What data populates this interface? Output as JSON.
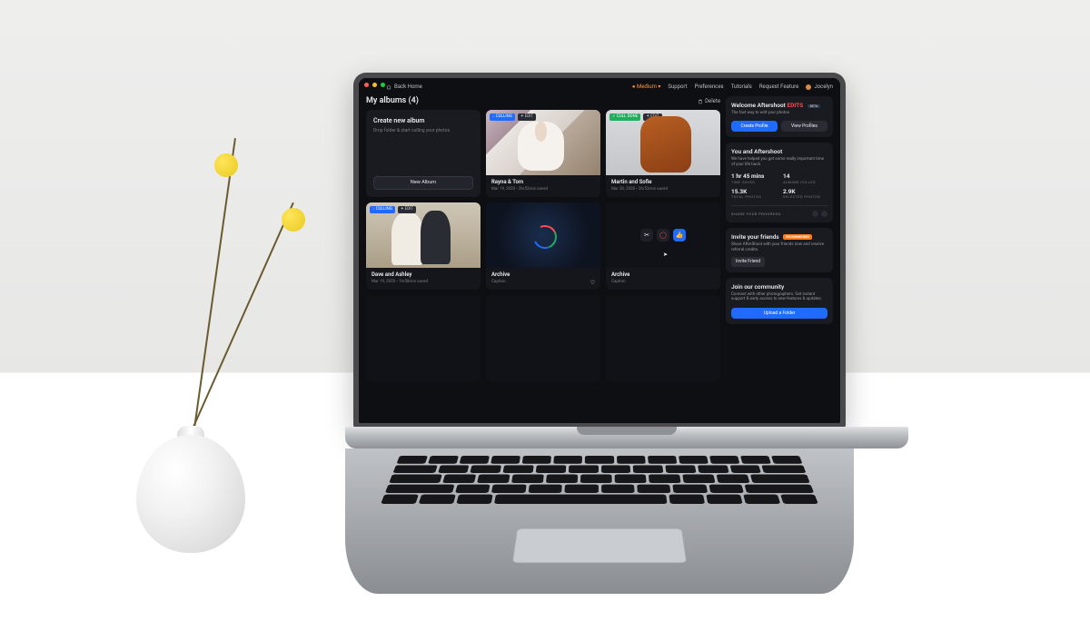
{
  "colors": {
    "accent": "#1f6bff",
    "danger": "#ff4d4d",
    "ok": "#1fae5b",
    "warn": "#ff7a1a"
  },
  "traffic": {
    "close": "#ff5f57",
    "min": "#febc2e",
    "max": "#28c840"
  },
  "topbar": {
    "back_home": "Back Home",
    "medium": "Medium",
    "support": "Support",
    "preferences": "Preferences",
    "tutorials": "Tutorials",
    "request_feature": "Request Feature",
    "user": "Jocelyn"
  },
  "main": {
    "title": "My albums (4)",
    "delete": "Delete",
    "create": {
      "heading": "Create new album",
      "tip": "Drop folder & start culling your photos",
      "button": "New Album"
    },
    "badges": {
      "culling": "CULLING",
      "cull_done": "CULL DONE",
      "edit": "EDIT"
    },
    "albums": [
      {
        "name": "Rayna & Tom",
        "sub": "Mar 19, 2020 • 2hr53min saved"
      },
      {
        "name": "Martin and Sofie",
        "sub": "Mar 30, 2020 • 2hr53min saved"
      },
      {
        "name": "Dave and Ashley",
        "sub": "Mar 19, 2020 • 1hr58min saved"
      },
      {
        "name": "Archive",
        "sub": "Caption"
      },
      {
        "name": "Archive",
        "sub": "Caption"
      }
    ]
  },
  "side": {
    "welcome": {
      "pre": "Welcome Aftershoot",
      "edits": "EDITS",
      "beta": "BETA",
      "sub": "The fast way to edit your photos",
      "primary": "Create Profile",
      "secondary": "View Profiles"
    },
    "stats_panel": {
      "title": "You and Aftershoot",
      "sub": "We have helped you get some really important time of your life back.",
      "stats": [
        {
          "v": "1 hr 45 mins",
          "l": "TIME SAVED"
        },
        {
          "v": "14",
          "l": "ALBUMS CULLED"
        },
        {
          "v": "15.3K",
          "l": "TOTAL PHOTOS"
        },
        {
          "v": "2.9K",
          "l": "SELECTED PHOTOS"
        }
      ],
      "share": "SHARE YOUR PROGRESS:"
    },
    "invite": {
      "title": "Invite your friends",
      "tag": "RECOMMENDED",
      "sub": "Share AfterShoot with your friends now and receive referral credits.",
      "button": "Invite Friend"
    },
    "community": {
      "title": "Join our community",
      "sub": "Connect with other photographers. Get instant support & early access to new features & updates.",
      "button": "Upload a Folder"
    }
  }
}
